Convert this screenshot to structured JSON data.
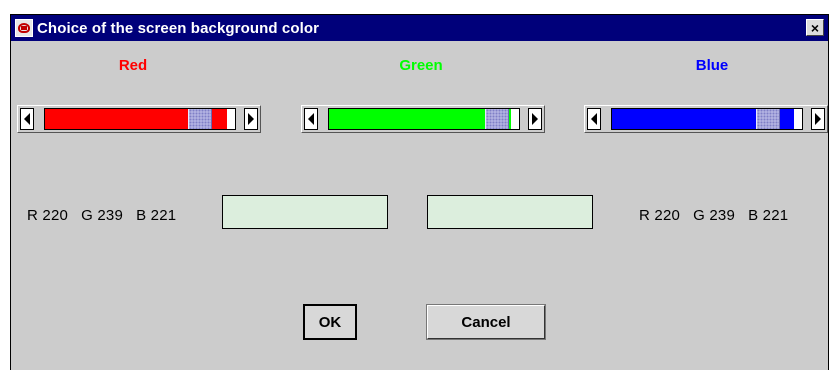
{
  "window": {
    "title": "Choice of the screen background color",
    "close_label": "×"
  },
  "channels": [
    {
      "label": "Red",
      "color": "#ff0000",
      "value": 220,
      "max": 255
    },
    {
      "label": "Green",
      "color": "#00ff00",
      "value": 239,
      "max": 255
    },
    {
      "label": "Blue",
      "color": "#0000ff",
      "value": 221,
      "max": 255
    }
  ],
  "readouts": {
    "left": "R 220   G 239   B 221",
    "right": "R 220   G 239   B 221"
  },
  "swatches": {
    "left_color": "#dceedd",
    "right_color": "#dceedd"
  },
  "buttons": {
    "ok": "OK",
    "cancel": "Cancel"
  },
  "colors": {
    "titlebar": "#00007a",
    "dialog_bg": "#cccccc",
    "thumb": "#b9b9e6"
  }
}
